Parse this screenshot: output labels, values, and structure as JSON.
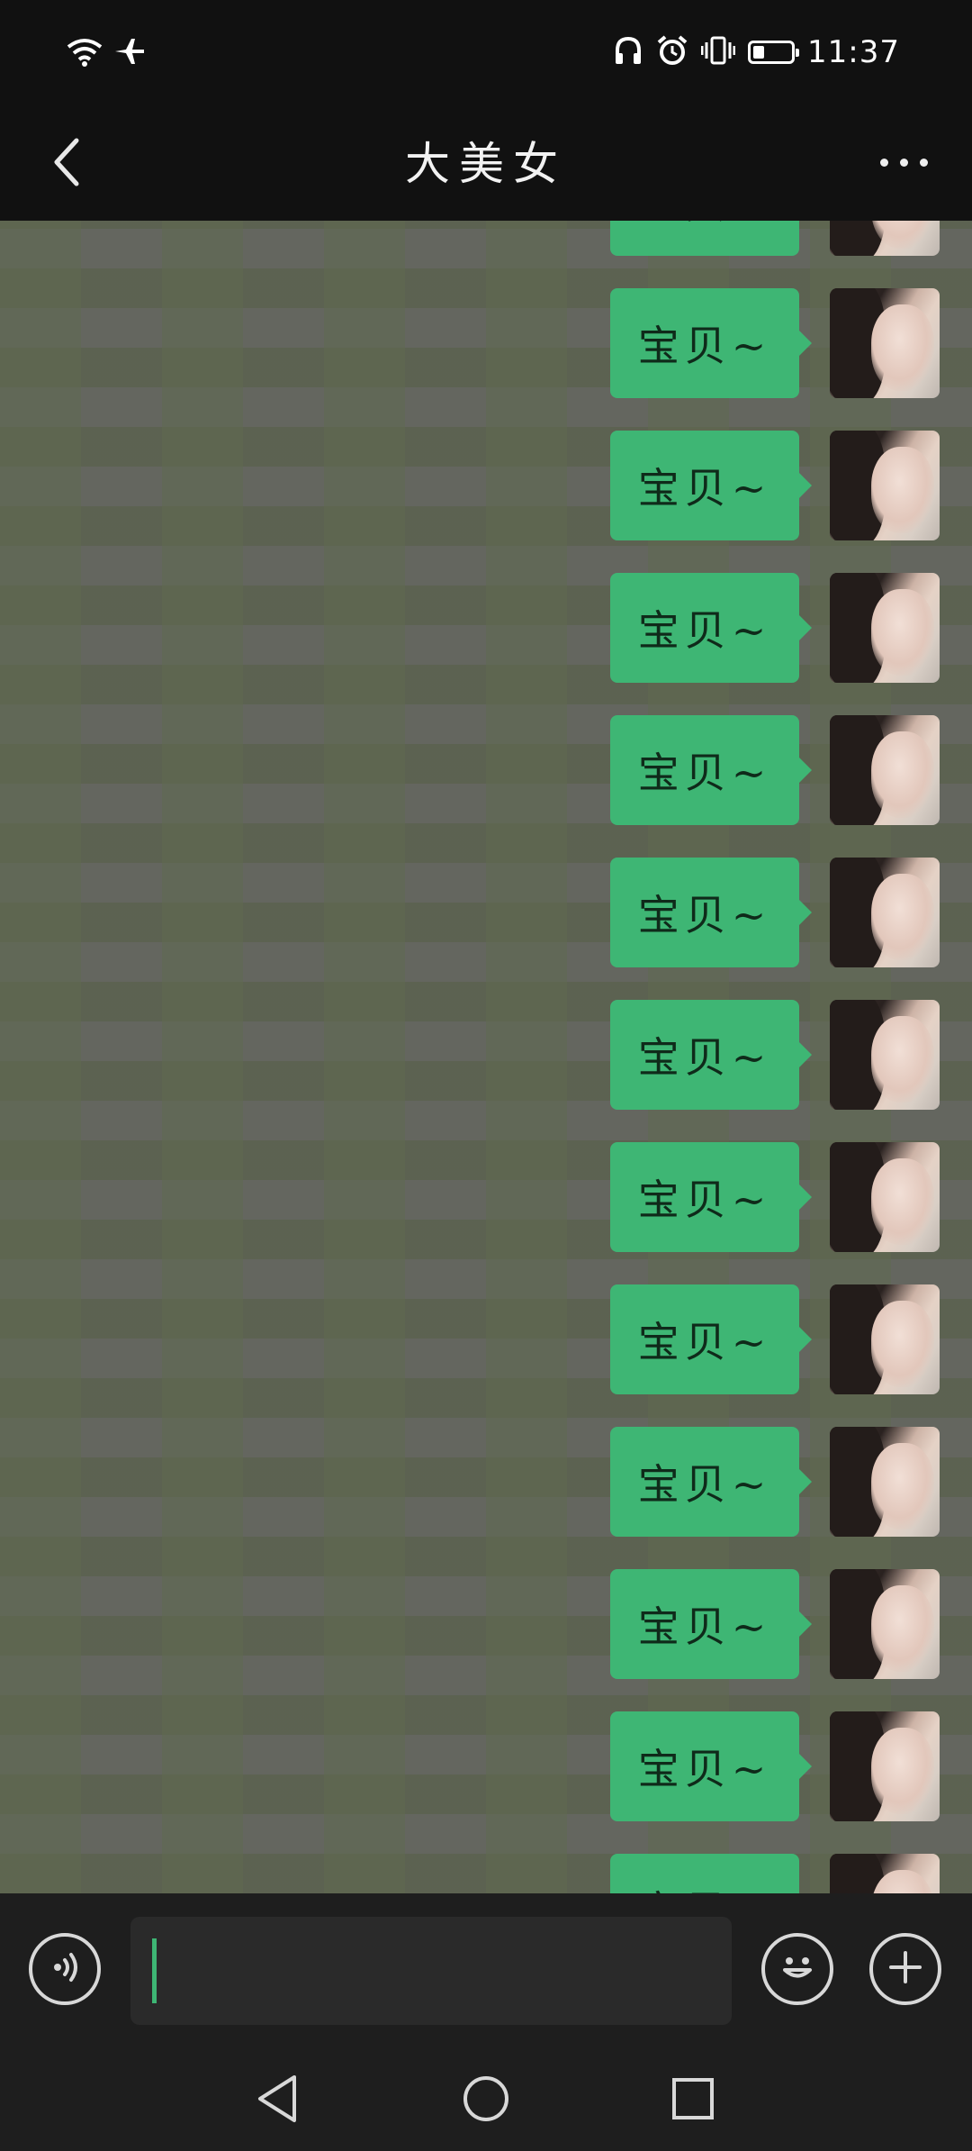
{
  "status_bar": {
    "time": "11:37",
    "battery_level": 0.3
  },
  "header": {
    "title": "大美女"
  },
  "messages": [
    {
      "text": "宝贝~",
      "sender": "me"
    },
    {
      "text": "宝贝~",
      "sender": "me"
    },
    {
      "text": "宝贝~",
      "sender": "me"
    },
    {
      "text": "宝贝~",
      "sender": "me"
    },
    {
      "text": "宝贝~",
      "sender": "me"
    },
    {
      "text": "宝贝~",
      "sender": "me"
    },
    {
      "text": "宝贝~",
      "sender": "me"
    },
    {
      "text": "宝贝~",
      "sender": "me"
    },
    {
      "text": "宝贝~",
      "sender": "me"
    },
    {
      "text": "宝贝~",
      "sender": "me"
    },
    {
      "text": "宝贝~",
      "sender": "me"
    },
    {
      "text": "宝贝~",
      "sender": "me"
    },
    {
      "text": "宝贝~",
      "sender": "me"
    },
    {
      "text": "宝贝~",
      "sender": "me"
    }
  ],
  "input": {
    "value": ""
  },
  "colors": {
    "bubble": "#3eb674",
    "cursor": "#3eb674",
    "bar": "#1e1e1e"
  },
  "icons": {
    "status": [
      "wifi-icon",
      "airplane-icon",
      "headphones-icon",
      "alarm-icon",
      "vibrate-icon",
      "battery-icon"
    ],
    "header": [
      "back-arrow-icon",
      "more-icon"
    ],
    "input": [
      "voice-icon",
      "emoji-icon",
      "plus-icon"
    ],
    "nav": [
      "nav-back-icon",
      "nav-home-icon",
      "nav-recents-icon"
    ]
  }
}
